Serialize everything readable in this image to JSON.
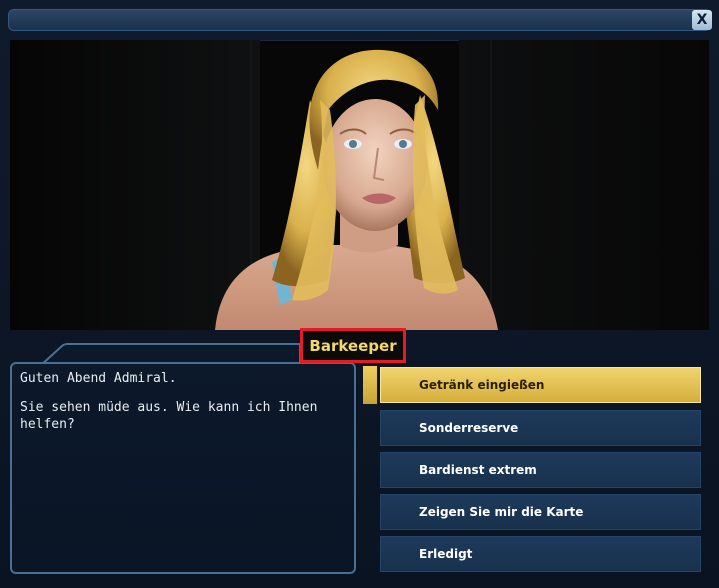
{
  "window": {
    "close_label": "X"
  },
  "npc": {
    "name": "Barkeeper"
  },
  "dialog": {
    "lines": [
      "Guten Abend Admiral.",
      "Sie sehen müde aus. Wie kann ich Ihnen helfen?"
    ]
  },
  "options": [
    {
      "label": "Getränk eingießen",
      "selected": true
    },
    {
      "label": "Sonderreserve",
      "selected": false
    },
    {
      "label": "Bardienst extrem",
      "selected": false
    },
    {
      "label": "Zeigen Sie mir die Karte",
      "selected": false
    },
    {
      "label": "Erledigt",
      "selected": false
    }
  ],
  "colors": {
    "highlight": "#e21d25",
    "name_text": "#f3d96a",
    "selected_option": "#e6c452",
    "option_bg": "#1b3554",
    "frame_border": "#4a6f94"
  }
}
